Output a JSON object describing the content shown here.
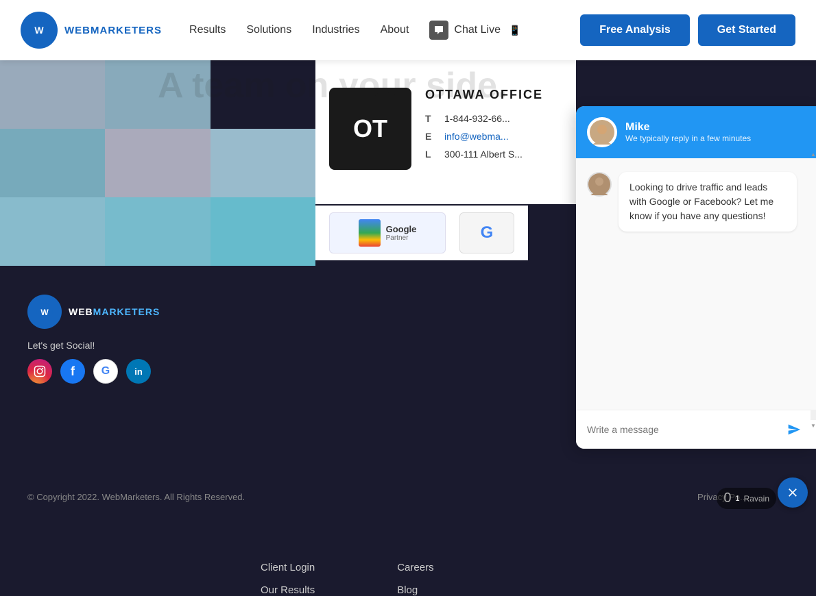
{
  "navbar": {
    "logo_initials": "W",
    "logo_name_part1": "WEB",
    "logo_name_part2": "MARKETERS",
    "nav_results": "Results",
    "nav_solutions": "Solutions",
    "nav_industries": "Industries",
    "nav_about": "About",
    "nav_chat": "Chat Live",
    "btn_free_analysis": "Free Analysis",
    "btn_get_started": "Get Started"
  },
  "hero": {
    "heading": "A team on your side."
  },
  "office": {
    "initials": "OT",
    "title": "OTTAWA OFFICE",
    "label_t": "T",
    "label_e": "E",
    "label_l": "L",
    "phone": "1-844-932-66...",
    "email": "info@webma...",
    "address": "300-111 Albert S..."
  },
  "partners": {
    "google_partner_label": "Google",
    "google_partner_sub": "Partner",
    "google_review_label": "G"
  },
  "footer": {
    "logo_initials": "W",
    "logo_name_part1": "WEB",
    "logo_name_part2": "MARKETERS",
    "social_label": "Let's get Social!",
    "col1": {
      "client_login": "Client Login",
      "our_results": "Our Results"
    },
    "col2": {
      "careers": "Careers",
      "blog": "Blog"
    },
    "copyright": "© Copyright 2022. WebMarketers. All Rights Reserved.",
    "privacy": "Privacy Po..."
  },
  "chat": {
    "agent_name": "Mike",
    "agent_status": "We typically reply in a few minutes",
    "message": "Looking to drive traffic and leads with Google or Facebook? Let me know if you have any questions!",
    "input_placeholder": "Write a message",
    "send_label": "➤"
  },
  "social_icons": {
    "instagram": "📷",
    "facebook": "f",
    "google": "G",
    "linkedin": "in"
  }
}
